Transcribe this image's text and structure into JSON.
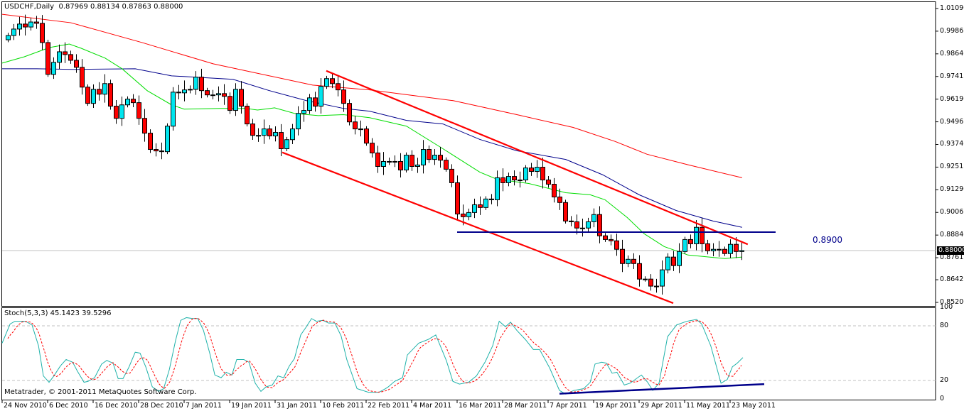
{
  "header": {
    "symbol": "USDCHF,Daily",
    "ohlc": "0.87969 0.88134 0.87863 0.88000"
  },
  "stoch_header": "Stoch(5,3,3) 45.1423 39.5296",
  "copyright": "Metatrader, © 2001-2011 MetaQuotes Software Corp.",
  "current_price_label": "0.88000",
  "level_label": "0.8900",
  "colors": {
    "bull": "#00e5ee",
    "bear": "#ff0000",
    "ma_slow": "#ff0000",
    "ma_mid": "#00008b",
    "ma_fast": "#00dd00",
    "stoch_main": "#20b2aa",
    "stoch_signal": "#ff0000",
    "trend": "#ff0000",
    "level": "#00008b"
  },
  "chart_data": {
    "type": "candlestick",
    "title": "USDCHF,Daily",
    "price_ticks": [
      "1.01090",
      "0.99865",
      "0.98640",
      "0.97415",
      "0.96190",
      "0.94965",
      "0.93740",
      "0.92515",
      "0.91290",
      "0.90065",
      "0.88840",
      "0.87615",
      "0.86425",
      "0.85200"
    ],
    "ylim": [
      0.852,
      1.0109
    ],
    "date_labels": [
      "24 Nov 2010",
      "6 Dec 2010",
      "16 Dec 2010",
      "28 Dec 2010",
      "7 Jan 2011",
      "19 Jan 2011",
      "31 Jan 2011",
      "10 Feb 2011",
      "22 Feb 2011",
      "4 Mar 2011",
      "16 Mar 2011",
      "28 Mar 2011",
      "7 Apr 2011",
      "19 Apr 2011",
      "29 Apr 2011",
      "11 May 2011",
      "23 May 2011"
    ],
    "first_open": 0.994,
    "closes": [
      0.9963,
      0.9998,
      1.0025,
      1.0009,
      1.0036,
      1.0029,
      0.9925,
      0.9753,
      0.9818,
      0.9875,
      0.986,
      0.9829,
      0.9791,
      0.9684,
      0.9596,
      0.9672,
      0.9646,
      0.9703,
      0.9581,
      0.9515,
      0.9588,
      0.9619,
      0.96,
      0.9515,
      0.9435,
      0.9347,
      0.9339,
      0.9335,
      0.9473,
      0.9657,
      0.9653,
      0.9669,
      0.9672,
      0.9738,
      0.9665,
      0.9642,
      0.9642,
      0.9649,
      0.9634,
      0.9558,
      0.9672,
      0.9581,
      0.9485,
      0.9423,
      0.9423,
      0.9458,
      0.942,
      0.9439,
      0.9351,
      0.94,
      0.9458,
      0.9542,
      0.9558,
      0.9626,
      0.9581,
      0.9688,
      0.973,
      0.9703,
      0.9669,
      0.9596,
      0.9496,
      0.9458,
      0.9458,
      0.9381,
      0.9328,
      0.9255,
      0.9282,
      0.9282,
      0.9282,
      0.9236,
      0.9316,
      0.9255,
      0.9263,
      0.9347,
      0.9293,
      0.9316,
      0.9289,
      0.924,
      0.9167,
      0.8998,
      0.8983,
      0.9006,
      0.9048,
      0.9033,
      0.9079,
      0.9075,
      0.9194,
      0.9167,
      0.9201,
      0.9182,
      0.9182,
      0.9247,
      0.9228,
      0.9251,
      0.9182,
      0.9159,
      0.909,
      0.906,
      0.896,
      0.8956,
      0.8922,
      0.8922,
      0.8956,
      0.8995,
      0.888,
      0.886,
      0.8853,
      0.8807,
      0.873,
      0.8753,
      0.873,
      0.8646,
      0.8646,
      0.8608,
      0.8608,
      0.8696,
      0.8765,
      0.8719,
      0.8795,
      0.886,
      0.8837,
      0.8926,
      0.8837,
      0.8799,
      0.8807,
      0.8807,
      0.8784,
      0.8834,
      0.8795,
      0.88
    ],
    "moving_averages": [
      {
        "name": "slow",
        "points": [
          [
            -1,
            1.0078
          ],
          [
            11.1,
            1.0032
          ],
          [
            23.6,
            0.9925
          ],
          [
            36.1,
            0.981
          ],
          [
            53.6,
            0.9695
          ],
          [
            63.6,
            0.9669
          ],
          [
            78.3,
            0.9611
          ],
          [
            89.5,
            0.9535
          ],
          [
            99.4,
            0.9466
          ],
          [
            106.8,
            0.939
          ],
          [
            112.4,
            0.9321
          ],
          [
            119.6,
            0.9264
          ],
          [
            129.1,
            0.9194
          ]
        ]
      },
      {
        "name": "mid",
        "points": [
          [
            -1,
            0.9783
          ],
          [
            5.1,
            0.9783
          ],
          [
            11.5,
            0.978
          ],
          [
            22.4,
            0.9783
          ],
          [
            28.8,
            0.9745
          ],
          [
            39.6,
            0.9726
          ],
          [
            46,
            0.9665
          ],
          [
            52.5,
            0.9611
          ],
          [
            59,
            0.9569
          ],
          [
            63.6,
            0.9554
          ],
          [
            70.1,
            0.9504
          ],
          [
            76.5,
            0.9485
          ],
          [
            83,
            0.9401
          ],
          [
            89.5,
            0.934
          ],
          [
            98.1,
            0.9293
          ],
          [
            104.6,
            0.921
          ],
          [
            111,
            0.9102
          ],
          [
            117.5,
            0.9017
          ],
          [
            124,
            0.896
          ],
          [
            129.1,
            0.8926
          ]
        ]
      },
      {
        "name": "fast",
        "points": [
          [
            -1,
            0.9814
          ],
          [
            2.9,
            0.9848
          ],
          [
            7.3,
            0.9898
          ],
          [
            10.8,
            0.9917
          ],
          [
            12.9,
            0.9894
          ],
          [
            17.1,
            0.9841
          ],
          [
            20.1,
            0.9783
          ],
          [
            24.5,
            0.9665
          ],
          [
            28.8,
            0.9588
          ],
          [
            31,
            0.9565
          ],
          [
            37.4,
            0.9569
          ],
          [
            41.8,
            0.9569
          ],
          [
            43.9,
            0.956
          ],
          [
            46.9,
            0.9572
          ],
          [
            50.4,
            0.9542
          ],
          [
            54.6,
            0.953
          ],
          [
            59,
            0.9535
          ],
          [
            63.6,
            0.9519
          ],
          [
            70.1,
            0.9473
          ],
          [
            76.5,
            0.9351
          ],
          [
            83,
            0.9224
          ],
          [
            86,
            0.9186
          ],
          [
            91.6,
            0.9163
          ],
          [
            98.1,
            0.9113
          ],
          [
            102.4,
            0.9102
          ],
          [
            105,
            0.9075
          ],
          [
            108.9,
            0.8979
          ],
          [
            111.9,
            0.8891
          ],
          [
            115.4,
            0.8822
          ],
          [
            119.6,
            0.8776
          ],
          [
            126.1,
            0.8757
          ],
          [
            129.1,
            0.8765
          ]
        ]
      }
    ],
    "trendlines": [
      {
        "name": "upper-channel",
        "from": [
          56,
          0.9772
        ],
        "to": [
          130.1,
          0.8834
        ]
      },
      {
        "name": "lower-channel",
        "from": [
          48.25,
          0.9331
        ],
        "to": [
          117,
          0.8516
        ]
      }
    ],
    "horizontal_level": {
      "price": 0.89,
      "from_index": 79,
      "to_index": 135
    },
    "current_price": 0.88,
    "stochastic": {
      "params": "5,3,3",
      "main_last": 45.1423,
      "signal_last": 39.5296,
      "levels": [
        80,
        20
      ],
      "axis_ticks": [
        "100",
        "80",
        "20",
        "0"
      ],
      "main": [
        [
          -1,
          61
        ],
        [
          0.4,
          82
        ],
        [
          1.25,
          85
        ],
        [
          3.1,
          85
        ],
        [
          4.25,
          81
        ],
        [
          5.4,
          58
        ],
        [
          6.25,
          25
        ],
        [
          7.25,
          18
        ],
        [
          8.1,
          25
        ],
        [
          9.25,
          36
        ],
        [
          10.25,
          43
        ],
        [
          11.4,
          40
        ],
        [
          12.25,
          30
        ],
        [
          13.4,
          18
        ],
        [
          14.1,
          19
        ],
        [
          15.25,
          23
        ],
        [
          16.5,
          38
        ],
        [
          17.4,
          42
        ],
        [
          18.5,
          39
        ],
        [
          19.4,
          22
        ],
        [
          20.25,
          22
        ],
        [
          21.25,
          34
        ],
        [
          22.4,
          51
        ],
        [
          23.25,
          50
        ],
        [
          24.25,
          35
        ],
        [
          25.4,
          13
        ],
        [
          26.5,
          8
        ],
        [
          27.4,
          11
        ],
        [
          28.4,
          32
        ],
        [
          29.5,
          64
        ],
        [
          30.4,
          86
        ],
        [
          31.4,
          89
        ],
        [
          32.5,
          88
        ],
        [
          33.4,
          88
        ],
        [
          34.4,
          75
        ],
        [
          35.5,
          50
        ],
        [
          36.4,
          26
        ],
        [
          37.5,
          23
        ],
        [
          38.4,
          29
        ],
        [
          39.4,
          26
        ],
        [
          40.25,
          43
        ],
        [
          41.5,
          43
        ],
        [
          42.4,
          40
        ],
        [
          43.5,
          17
        ],
        [
          44.5,
          8
        ],
        [
          45.4,
          13
        ],
        [
          46.5,
          15
        ],
        [
          47.5,
          25
        ],
        [
          48.5,
          23
        ],
        [
          49.5,
          36
        ],
        [
          50.4,
          44
        ],
        [
          51.5,
          70
        ],
        [
          52.5,
          79
        ],
        [
          53.4,
          88
        ],
        [
          54.25,
          85
        ],
        [
          55.4,
          86
        ],
        [
          56.4,
          83
        ],
        [
          57.5,
          83
        ],
        [
          58.6,
          69
        ],
        [
          59.6,
          43
        ],
        [
          61.4,
          11
        ],
        [
          63.4,
          7
        ],
        [
          65.25,
          7
        ],
        [
          66.4,
          11
        ],
        [
          66.9,
          13
        ],
        [
          68,
          19
        ],
        [
          69.4,
          23
        ],
        [
          70.25,
          48
        ],
        [
          72.25,
          61
        ],
        [
          73.9,
          65
        ],
        [
          75.25,
          70
        ],
        [
          77.1,
          42
        ],
        [
          78.25,
          19
        ],
        [
          79.4,
          16
        ],
        [
          81,
          18
        ],
        [
          82.4,
          25
        ],
        [
          83.9,
          40
        ],
        [
          85.25,
          58
        ],
        [
          86.4,
          85
        ],
        [
          87.5,
          79
        ],
        [
          88.4,
          84
        ],
        [
          89.5,
          75
        ],
        [
          91,
          65
        ],
        [
          92.4,
          54
        ],
        [
          93.5,
          54
        ],
        [
          95.25,
          34
        ],
        [
          97,
          9
        ],
        [
          98.1,
          5
        ],
        [
          99.5,
          9
        ],
        [
          101.25,
          11
        ],
        [
          102.4,
          18
        ],
        [
          103.25,
          38
        ],
        [
          104.4,
          40
        ],
        [
          105.25,
          39
        ],
        [
          106.25,
          28
        ],
        [
          107.1,
          29
        ],
        [
          108.4,
          15
        ],
        [
          109.4,
          17
        ],
        [
          111.4,
          26
        ],
        [
          112.5,
          18
        ],
        [
          113.4,
          9
        ],
        [
          114.5,
          17
        ],
        [
          116,
          68
        ],
        [
          117.6,
          81
        ],
        [
          119.4,
          85
        ],
        [
          121.1,
          87
        ],
        [
          122,
          82
        ],
        [
          123.6,
          58
        ],
        [
          125.4,
          17
        ],
        [
          126.5,
          21
        ],
        [
          127.4,
          35
        ],
        [
          128.25,
          39
        ],
        [
          129.25,
          45.14
        ]
      ],
      "trendline": {
        "from": [
          97,
          5.5
        ],
        "to": [
          133,
          16
        ]
      }
    }
  }
}
